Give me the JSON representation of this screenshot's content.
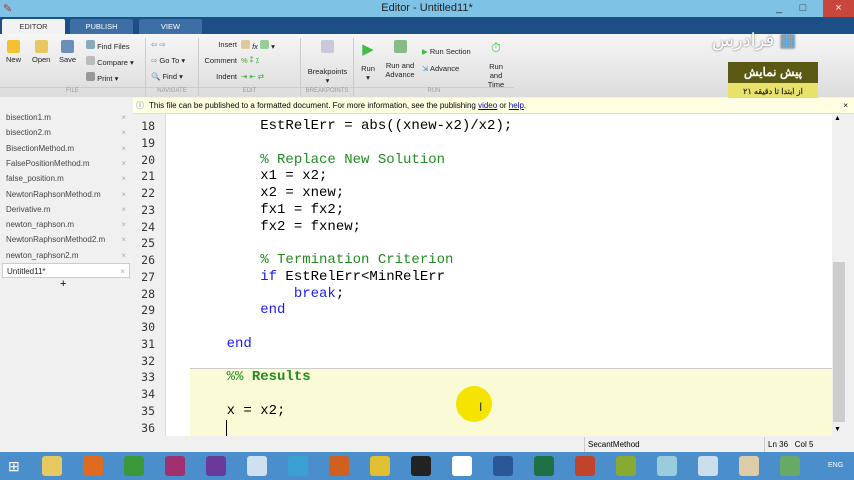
{
  "window": {
    "title": "Editor - Untitled11*",
    "minimize": "_",
    "maximize": "□",
    "close": "×"
  },
  "tabs": [
    {
      "label": "EDITOR"
    },
    {
      "label": "PUBLISH"
    },
    {
      "label": "VIEW"
    }
  ],
  "ribbon": {
    "file": {
      "new": "New",
      "open": "Open",
      "save": "Save",
      "find_files": "Find Files",
      "compare": "Compare",
      "print": "Print",
      "group": "FILE"
    },
    "navigate": {
      "goto": "Go To",
      "find": "Find",
      "group": "NAVIGATE"
    },
    "edit": {
      "insert": "Insert",
      "comment": "Comment",
      "indent": "Indent",
      "fx": "fx",
      "group": "EDIT"
    },
    "breakpoints": {
      "label": "Breakpoints",
      "group": "BREAKPOINTS"
    },
    "run": {
      "run": "Run",
      "run_advance": "Run and Advance",
      "run_section": "Run Section",
      "advance": "Advance",
      "run_time": "Run and Time",
      "group": "RUN"
    }
  },
  "watermark": {
    "logo": "فرادرس",
    "promo_title": "پیش نمایش",
    "promo_sub": "از ابتدا تا دقیقه ۲۱"
  },
  "infobar": {
    "text": "This file can be published to a formatted document. For more information, see the publishing ",
    "link1": "video",
    "mid": " or ",
    "link2": "help",
    "end": ".",
    "close": "×"
  },
  "files": [
    {
      "name": "bisection1.m"
    },
    {
      "name": "bisection2.m"
    },
    {
      "name": "BisectionMethod.m"
    },
    {
      "name": "FalsePositionMethod.m"
    },
    {
      "name": "false_position.m"
    },
    {
      "name": "NewtonRaphsonMethod.m"
    },
    {
      "name": "Derivative.m"
    },
    {
      "name": "newton_raphson.m"
    },
    {
      "name": "NewtonRaphsonMethod2.m"
    },
    {
      "name": "newton_raphson2.m"
    },
    {
      "name": "Untitled11*",
      "active": true
    }
  ],
  "add_file": "+",
  "code": [
    {
      "n": "18",
      "s": [
        [
          "n",
          "        EstRelErr = abs((xnew-x2)/x2);"
        ]
      ]
    },
    {
      "n": "19",
      "s": []
    },
    {
      "n": "20",
      "s": [
        [
          "cm",
          "        % Replace New Solution"
        ]
      ]
    },
    {
      "n": "21",
      "s": [
        [
          "n",
          "        x1 = x2;"
        ]
      ]
    },
    {
      "n": "22",
      "s": [
        [
          "n",
          "        x2 = xnew;"
        ]
      ]
    },
    {
      "n": "23",
      "s": [
        [
          "n",
          "        fx1 = fx2;"
        ]
      ]
    },
    {
      "n": "24",
      "s": [
        [
          "n",
          "        fx2 = fxnew;"
        ]
      ]
    },
    {
      "n": "25",
      "s": []
    },
    {
      "n": "26",
      "s": [
        [
          "cm",
          "        % Termination Criterion"
        ]
      ]
    },
    {
      "n": "27",
      "s": [
        [
          "kw",
          "        if"
        ],
        [
          "n",
          " EstRelErr<MinRelErr"
        ]
      ]
    },
    {
      "n": "28",
      "s": [
        [
          "kw",
          "            break"
        ],
        [
          "n",
          ";"
        ]
      ]
    },
    {
      "n": "29",
      "s": [
        [
          "kw",
          "        end"
        ]
      ]
    },
    {
      "n": "30",
      "s": []
    },
    {
      "n": "31",
      "s": [
        [
          "kw",
          "    end"
        ]
      ]
    },
    {
      "n": "32",
      "s": []
    },
    {
      "n": "33",
      "s": [
        [
          "cm",
          "    %% "
        ],
        [
          "cb",
          "Results"
        ]
      ]
    },
    {
      "n": "34",
      "s": []
    },
    {
      "n": "35",
      "s": [
        [
          "n",
          "    x = x2;"
        ]
      ]
    },
    {
      "n": "36",
      "s": [
        [
          "n",
          "    "
        ]
      ]
    }
  ],
  "status": {
    "function": "SecantMethod",
    "ln_label": "Ln",
    "ln": "36",
    "col_label": "Col",
    "col": "5"
  },
  "taskbar": {
    "lang": "ENG",
    "apps": [
      "file-explorer",
      "firefox",
      "chrome",
      "winrar",
      "visual-studio",
      "virtualbox",
      "app",
      "matlab",
      "app",
      "cmd",
      "notepad",
      "word",
      "excel",
      "powerpoint",
      "app",
      "app",
      "calculator",
      "paint",
      "app"
    ]
  }
}
